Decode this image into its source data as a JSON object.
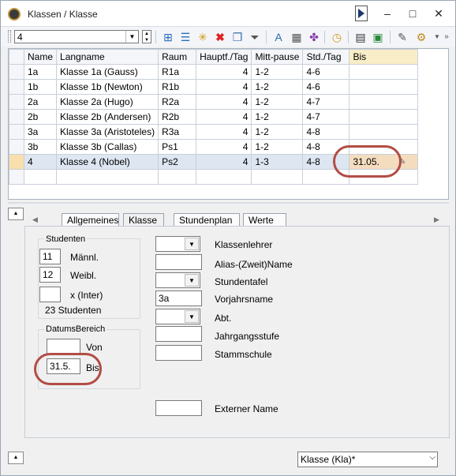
{
  "window": {
    "title": "Klassen / Klasse",
    "minimize": "–",
    "maximize": "□",
    "close": "✕"
  },
  "toolbar": {
    "filter_value": "4"
  },
  "grid": {
    "columns": [
      "Name",
      "Langname",
      "Raum",
      "Hauptf./Tag",
      "Mitt-pause",
      "Std./Tag",
      "Bis"
    ],
    "rows": [
      [
        "1a",
        "Klasse 1a (Gauss)",
        "R1a",
        "4",
        "1-2",
        "4-6",
        ""
      ],
      [
        "1b",
        "Klasse 1b (Newton)",
        "R1b",
        "4",
        "1-2",
        "4-6",
        ""
      ],
      [
        "2a",
        "Klasse 2a (Hugo)",
        "R2a",
        "4",
        "1-2",
        "4-7",
        ""
      ],
      [
        "2b",
        "Klasse 2b (Andersen)",
        "R2b",
        "4",
        "1-2",
        "4-7",
        ""
      ],
      [
        "3a",
        "Klasse 3a (Aristoteles)",
        "R3a",
        "4",
        "1-2",
        "4-8",
        ""
      ],
      [
        "3b",
        "Klasse 3b (Callas)",
        "Ps1",
        "4",
        "1-2",
        "4-8",
        ""
      ],
      [
        "4",
        "Klasse 4 (Nobel)",
        "Ps2",
        "4",
        "1-3",
        "4-8",
        "31.05."
      ]
    ]
  },
  "tabs": [
    "Allgemeines",
    "Klasse",
    "Stundenplan",
    "Werte"
  ],
  "students": {
    "group_label": "Studenten",
    "male_value": "11",
    "male_label": "Männl.",
    "female_value": "12",
    "female_label": "Weibl.",
    "inter_value": "",
    "inter_label": "x (Inter)",
    "total": "23 Studenten"
  },
  "date_range": {
    "group_label": "DatumsBereich",
    "from_value": "",
    "from_label": "Von",
    "to_value": "31.5.",
    "to_label": "Bis"
  },
  "right_fields": {
    "klassenlehrer": "Klassenlehrer",
    "alias": "Alias-(Zweit)Name",
    "stundentafel": "Stundentafel",
    "vorjahr_label": "Vorjahrsname",
    "vorjahr_value": "3a",
    "abt": "Abt.",
    "jahrgangsstufe": "Jahrgangsstufe",
    "stammschule": "Stammschule",
    "extern": "Externer Name"
  },
  "footer": {
    "view_select": "Klasse (Kla)*"
  }
}
